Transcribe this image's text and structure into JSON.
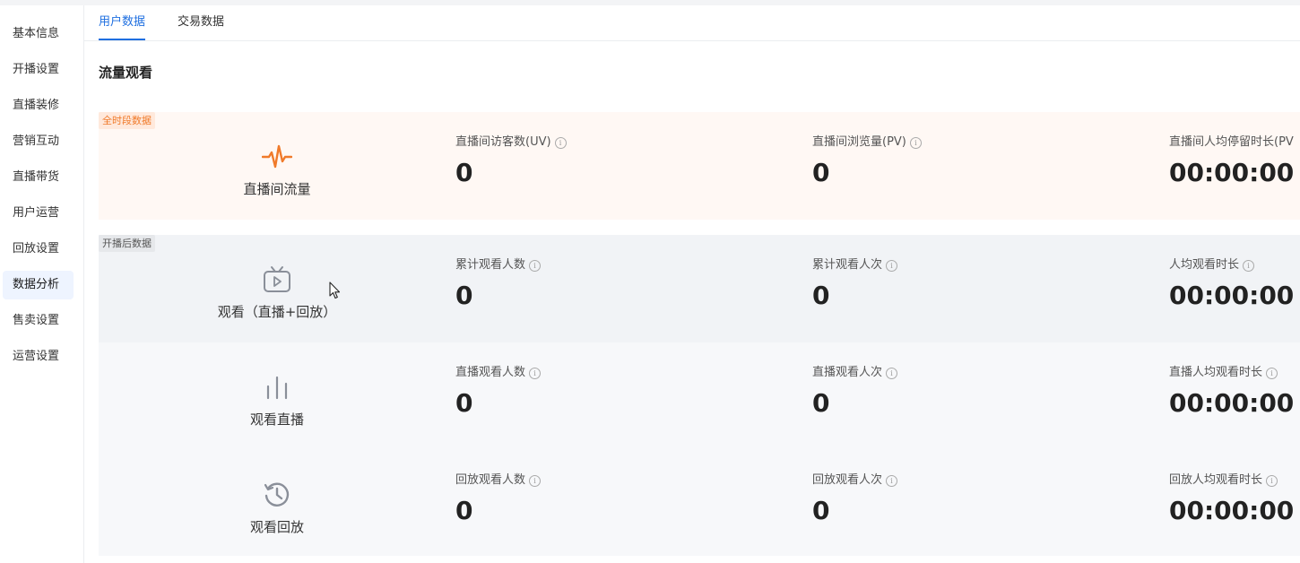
{
  "sidebar": {
    "items": [
      {
        "label": "基本信息"
      },
      {
        "label": "开播设置"
      },
      {
        "label": "直播装修"
      },
      {
        "label": "营销互动"
      },
      {
        "label": "直播带货"
      },
      {
        "label": "用户运营"
      },
      {
        "label": "回放设置"
      },
      {
        "label": "数据分析",
        "active": true
      },
      {
        "label": "售卖设置"
      },
      {
        "label": "运营设置"
      }
    ]
  },
  "tabs": [
    {
      "label": "用户数据",
      "active": true
    },
    {
      "label": "交易数据"
    }
  ],
  "section_title": "流量观看",
  "panels": {
    "all_time": {
      "badge": "全时段数据",
      "rows": [
        {
          "title": "直播间流量",
          "icon": "pulse-icon",
          "metrics": [
            {
              "label": "直播间访客数(UV)",
              "value": "0"
            },
            {
              "label": "直播间浏览量(PV)",
              "value": "0"
            },
            {
              "label": "直播间人均停留时长(PV",
              "value": "00:00:00"
            }
          ]
        }
      ]
    },
    "after_start": {
      "badge": "开播后数据",
      "rows": [
        {
          "title": "观看（直播+回放）",
          "icon": "tv-icon",
          "metrics": [
            {
              "label": "累计观看人数",
              "value": "0"
            },
            {
              "label": "累计观看人次",
              "value": "0"
            },
            {
              "label": "人均观看时长",
              "value": "00:00:00"
            }
          ]
        },
        {
          "title": "观看直播",
          "icon": "bars-icon",
          "metrics": [
            {
              "label": "直播观看人数",
              "value": "0"
            },
            {
              "label": "直播观看人次",
              "value": "0"
            },
            {
              "label": "直播人均观看时长",
              "value": "00:00:00"
            }
          ]
        },
        {
          "title": "观看回放",
          "icon": "history-icon",
          "metrics": [
            {
              "label": "回放观看人数",
              "value": "0"
            },
            {
              "label": "回放观看人次",
              "value": "0"
            },
            {
              "label": "回放人均观看时长",
              "value": "00:00:00"
            }
          ]
        }
      ]
    }
  },
  "colors": {
    "accent": "#1f6fe0",
    "orange": "#f07a2a",
    "icon_gray": "#8a8f99"
  }
}
